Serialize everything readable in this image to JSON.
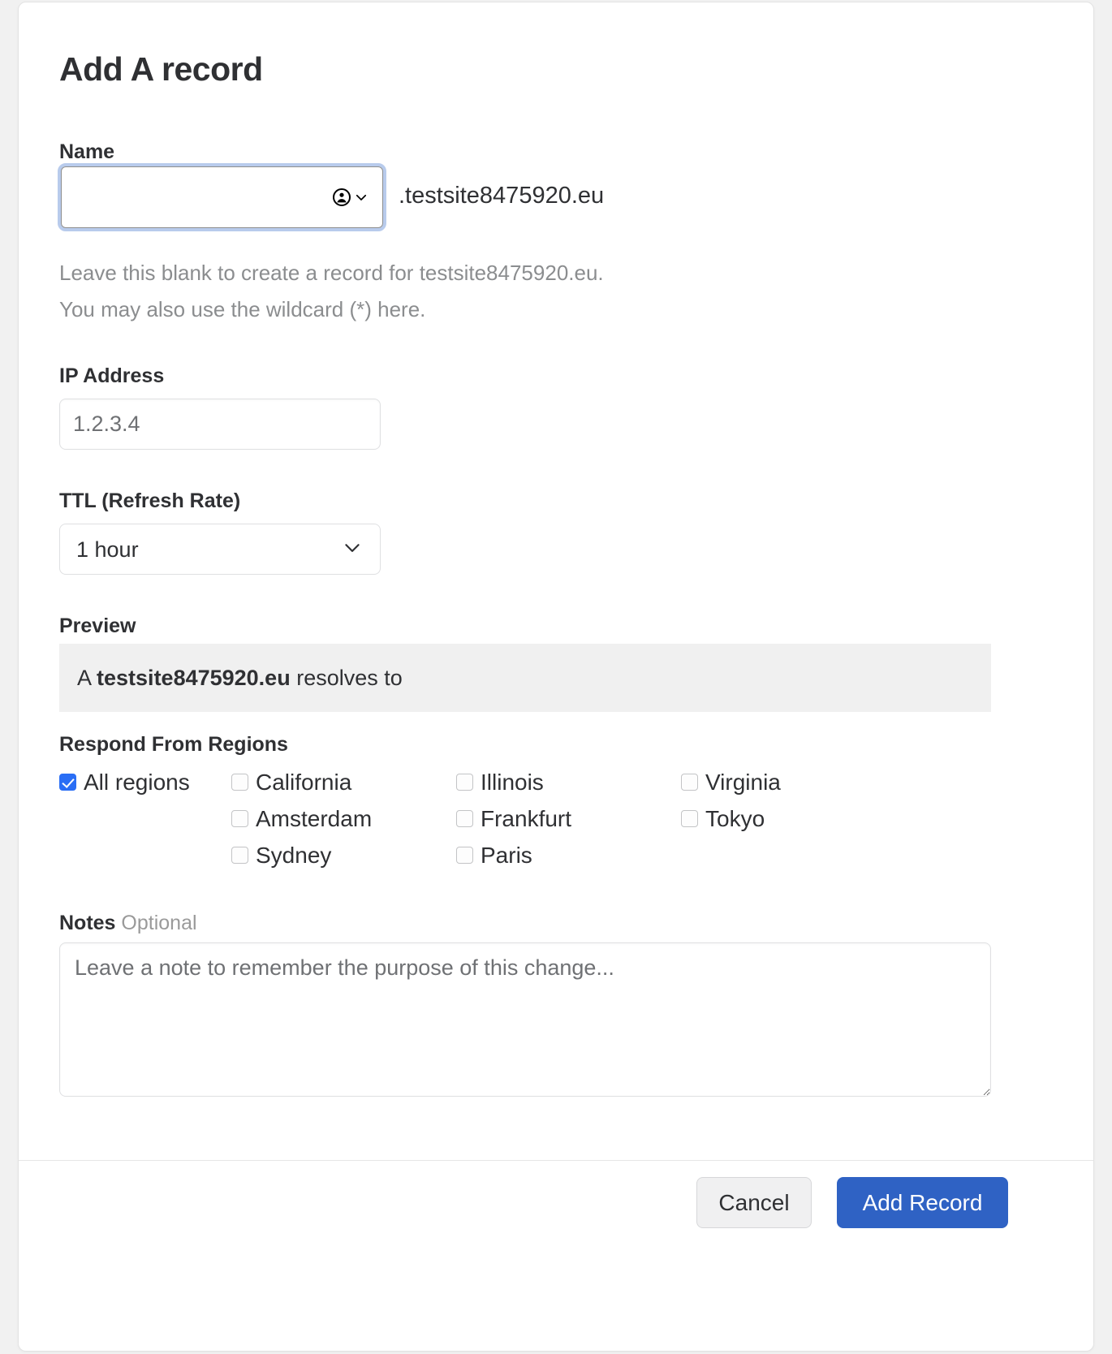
{
  "dialog": {
    "title": "Add A record"
  },
  "name_field": {
    "label": "Name",
    "value": "",
    "placeholder": "",
    "autofill_icon": "person-autofill-icon",
    "caret_icon": "chevron-down-icon",
    "domain_suffix": ".testsite8475920.eu",
    "helper_line_1": "Leave this blank to create a record for testsite8475920.eu.",
    "helper_line_2": "You may also use the wildcard (*) here.",
    "focus_ring_color": "#b8cbec"
  },
  "ip_field": {
    "label": "IP Address",
    "value": "",
    "placeholder": "1.2.3.4"
  },
  "ttl_field": {
    "label": "TTL (Refresh Rate)",
    "selected": "1 hour",
    "options": [
      "1 hour"
    ],
    "caret_icon": "chevron-down-icon"
  },
  "preview": {
    "label": "Preview",
    "prefix": "A ",
    "domain": "testsite8475920.eu",
    "suffix": " resolves to",
    "background": "#f0f0f0"
  },
  "regions": {
    "label": "Respond From Regions",
    "accent_color": "#2a6ef5",
    "rows": [
      [
        {
          "label": "All regions",
          "checked": true
        },
        {
          "label": "California",
          "checked": false
        },
        {
          "label": "Illinois",
          "checked": false
        },
        {
          "label": "Virginia",
          "checked": false
        }
      ],
      [
        {
          "label": "",
          "checked": false
        },
        {
          "label": "Amsterdam",
          "checked": false
        },
        {
          "label": "Frankfurt",
          "checked": false
        },
        {
          "label": "Tokyo",
          "checked": false
        }
      ],
      [
        {
          "label": "",
          "checked": false
        },
        {
          "label": "Sydney",
          "checked": false
        },
        {
          "label": "Paris",
          "checked": false
        },
        {
          "label": "",
          "checked": false
        }
      ]
    ]
  },
  "notes": {
    "label": "Notes",
    "optional_label": "Optional",
    "value": "",
    "placeholder": "Leave a note to remember the purpose of this change..."
  },
  "footer": {
    "cancel_label": "Cancel",
    "submit_label": "Add Record",
    "primary_color": "#2f62c4"
  }
}
